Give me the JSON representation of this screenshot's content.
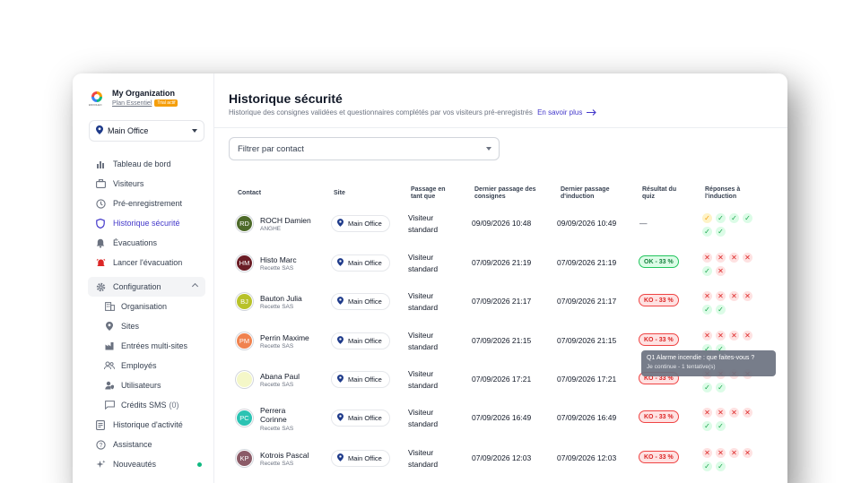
{
  "organization": {
    "name": "My Organization",
    "plan": "Plan Essentiel",
    "trial_badge": "Trial actif",
    "logo_brand": "ENVOLEO"
  },
  "site_selector": {
    "value": "Main Office"
  },
  "nav": {
    "items": [
      {
        "label": "Tableau de bord",
        "icon": "bar-chart-icon"
      },
      {
        "label": "Visiteurs",
        "icon": "briefcase-icon"
      },
      {
        "label": "Pré-enregistrement",
        "icon": "clock-icon"
      },
      {
        "label": "Historique sécurité",
        "icon": "shield-icon",
        "active": true
      },
      {
        "label": "Évacuations",
        "icon": "bell-icon"
      },
      {
        "label": "Lancer l'évacuation",
        "icon": "alarm-icon"
      }
    ],
    "configuration": {
      "label": "Configuration",
      "items": [
        {
          "label": "Organisation",
          "icon": "building-icon"
        },
        {
          "label": "Sites",
          "icon": "map-pin-icon"
        },
        {
          "label": "Entrées multi-sites",
          "icon": "factory-icon"
        },
        {
          "label": "Employés",
          "icon": "users-icon"
        },
        {
          "label": "Utilisateurs",
          "icon": "user-shield-icon"
        },
        {
          "label": "Crédits SMS",
          "count": "(0)",
          "icon": "message-icon"
        }
      ]
    },
    "bottom": [
      {
        "label": "Historique d'activité",
        "icon": "history-icon"
      },
      {
        "label": "Assistance",
        "icon": "help-icon"
      },
      {
        "label": "Nouveautés",
        "icon": "sparkle-icon"
      }
    ]
  },
  "page": {
    "title": "Historique sécurité",
    "subtitle": "Historique des consignes validées et questionnaires complétés par vos visiteurs pré-enregistrés",
    "learn_more": "En savoir plus",
    "filter_placeholder": "Filtrer par contact"
  },
  "table": {
    "headers": {
      "contact": "Contact",
      "site": "Site",
      "pass_l1": "Passage en",
      "pass_l2": "tant que",
      "last_pass_l1": "Dernier passage des",
      "last_pass_l2": "consignes",
      "last_ind_l1": "Dernier passage",
      "last_ind_l2": "d'induction",
      "quiz_l1": "Résultat du",
      "quiz_l2": "quiz",
      "answers_l1": "Réponses à",
      "answers_l2": "l'induction"
    },
    "rows": [
      {
        "initials": "RD",
        "avatar_color": "#4d6a2a",
        "name": "ROCH Damien",
        "company": "ANGHE",
        "site": "Main Office",
        "pass_l1": "Visiteur",
        "pass_l2": "standard",
        "last_pass": "09/09/2026 10:48",
        "last_induction": "09/09/2026 10:49",
        "result": "—",
        "result_type": "none",
        "answers": [
          [
            "warn",
            "ok",
            "ok",
            "ok"
          ],
          [
            "ok",
            "ok"
          ]
        ]
      },
      {
        "initials": "HM",
        "avatar_color": "#6b1d26",
        "name": "Histo Marc",
        "company": "Recette SAS",
        "site": "Main Office",
        "pass_l1": "Visiteur",
        "pass_l2": "standard",
        "last_pass": "07/09/2026 21:19",
        "last_induction": "07/09/2026 21:19",
        "result": "OK - 33 %",
        "result_type": "ok",
        "answers": [
          [
            "ko",
            "ko",
            "ko",
            "ko"
          ],
          [
            "ok",
            "ko"
          ]
        ]
      },
      {
        "initials": "BJ",
        "avatar_color": "#b8c22a",
        "name": "Bauton Julia",
        "company": "Recette SAS",
        "site": "Main Office",
        "pass_l1": "Visiteur",
        "pass_l2": "standard",
        "last_pass": "07/09/2026 21:17",
        "last_induction": "07/09/2026 21:17",
        "result": "KO - 33 %",
        "result_type": "ko",
        "answers": [
          [
            "ko",
            "ko",
            "ko",
            "ko"
          ],
          [
            "ok",
            "ok"
          ]
        ]
      },
      {
        "initials": "PM",
        "avatar_color": "#f0824f",
        "name": "Perrin Maxime",
        "company": "Recette SAS",
        "site": "Main Office",
        "pass_l1": "Visiteur",
        "pass_l2": "standard",
        "last_pass": "07/09/2026 21:15",
        "last_induction": "07/09/2026 21:15",
        "result": "KO - 33 %",
        "result_type": "ko",
        "answers": [
          [
            "ko",
            "ko",
            "ko",
            "ko"
          ],
          [
            "ok",
            "ok"
          ]
        ]
      },
      {
        "initials": "",
        "avatar_color": "#f4f7c8",
        "name": "Abana Paul",
        "company": "Recette SAS",
        "site": "Main Office",
        "pass_l1": "Visiteur",
        "pass_l2": "standard",
        "last_pass": "07/09/2026 17:21",
        "last_induction": "07/09/2026 17:21",
        "result": "KO - 33 %",
        "result_type": "ko",
        "answers": [
          [
            "ko",
            "ko",
            "ko",
            "ko"
          ],
          [
            "ok",
            "ok"
          ]
        ]
      },
      {
        "initials": "PC",
        "avatar_color": "#2bc3b3",
        "name_l1": "Perrera",
        "name_l2": "Corinne",
        "company": "Recette SAS",
        "site": "Main Office",
        "pass_l1": "Visiteur",
        "pass_l2": "standard",
        "last_pass": "07/09/2026 16:49",
        "last_induction": "07/09/2026 16:49",
        "result": "KO - 33 %",
        "result_type": "ko",
        "answers": [
          [
            "ko",
            "ko",
            "ko",
            "ko"
          ],
          [
            "ok",
            "ok"
          ]
        ]
      },
      {
        "initials": "KP",
        "avatar_color": "#8b5b67",
        "name": "Kotrois Pascal",
        "company": "Recette SAS",
        "site": "Main Office",
        "pass_l1": "Visiteur",
        "pass_l2": "standard",
        "last_pass": "07/09/2026 12:03",
        "last_induction": "07/09/2026 12:03",
        "result": "KO - 33 %",
        "result_type": "ko",
        "answers": [
          [
            "ko",
            "ko",
            "ko",
            "ko"
          ],
          [
            "ok",
            "ok"
          ]
        ]
      }
    ]
  },
  "tooltip": {
    "title": "Q1 Alarme incendie : que faites-vous ?",
    "subtitle": "Je continue - 1 tentative(s)"
  },
  "colors": {
    "accent": "#4338ca",
    "ok": "#16a34a",
    "ko": "#dc2626",
    "warn": "#f59e0b",
    "new_dot": "#10b981"
  }
}
